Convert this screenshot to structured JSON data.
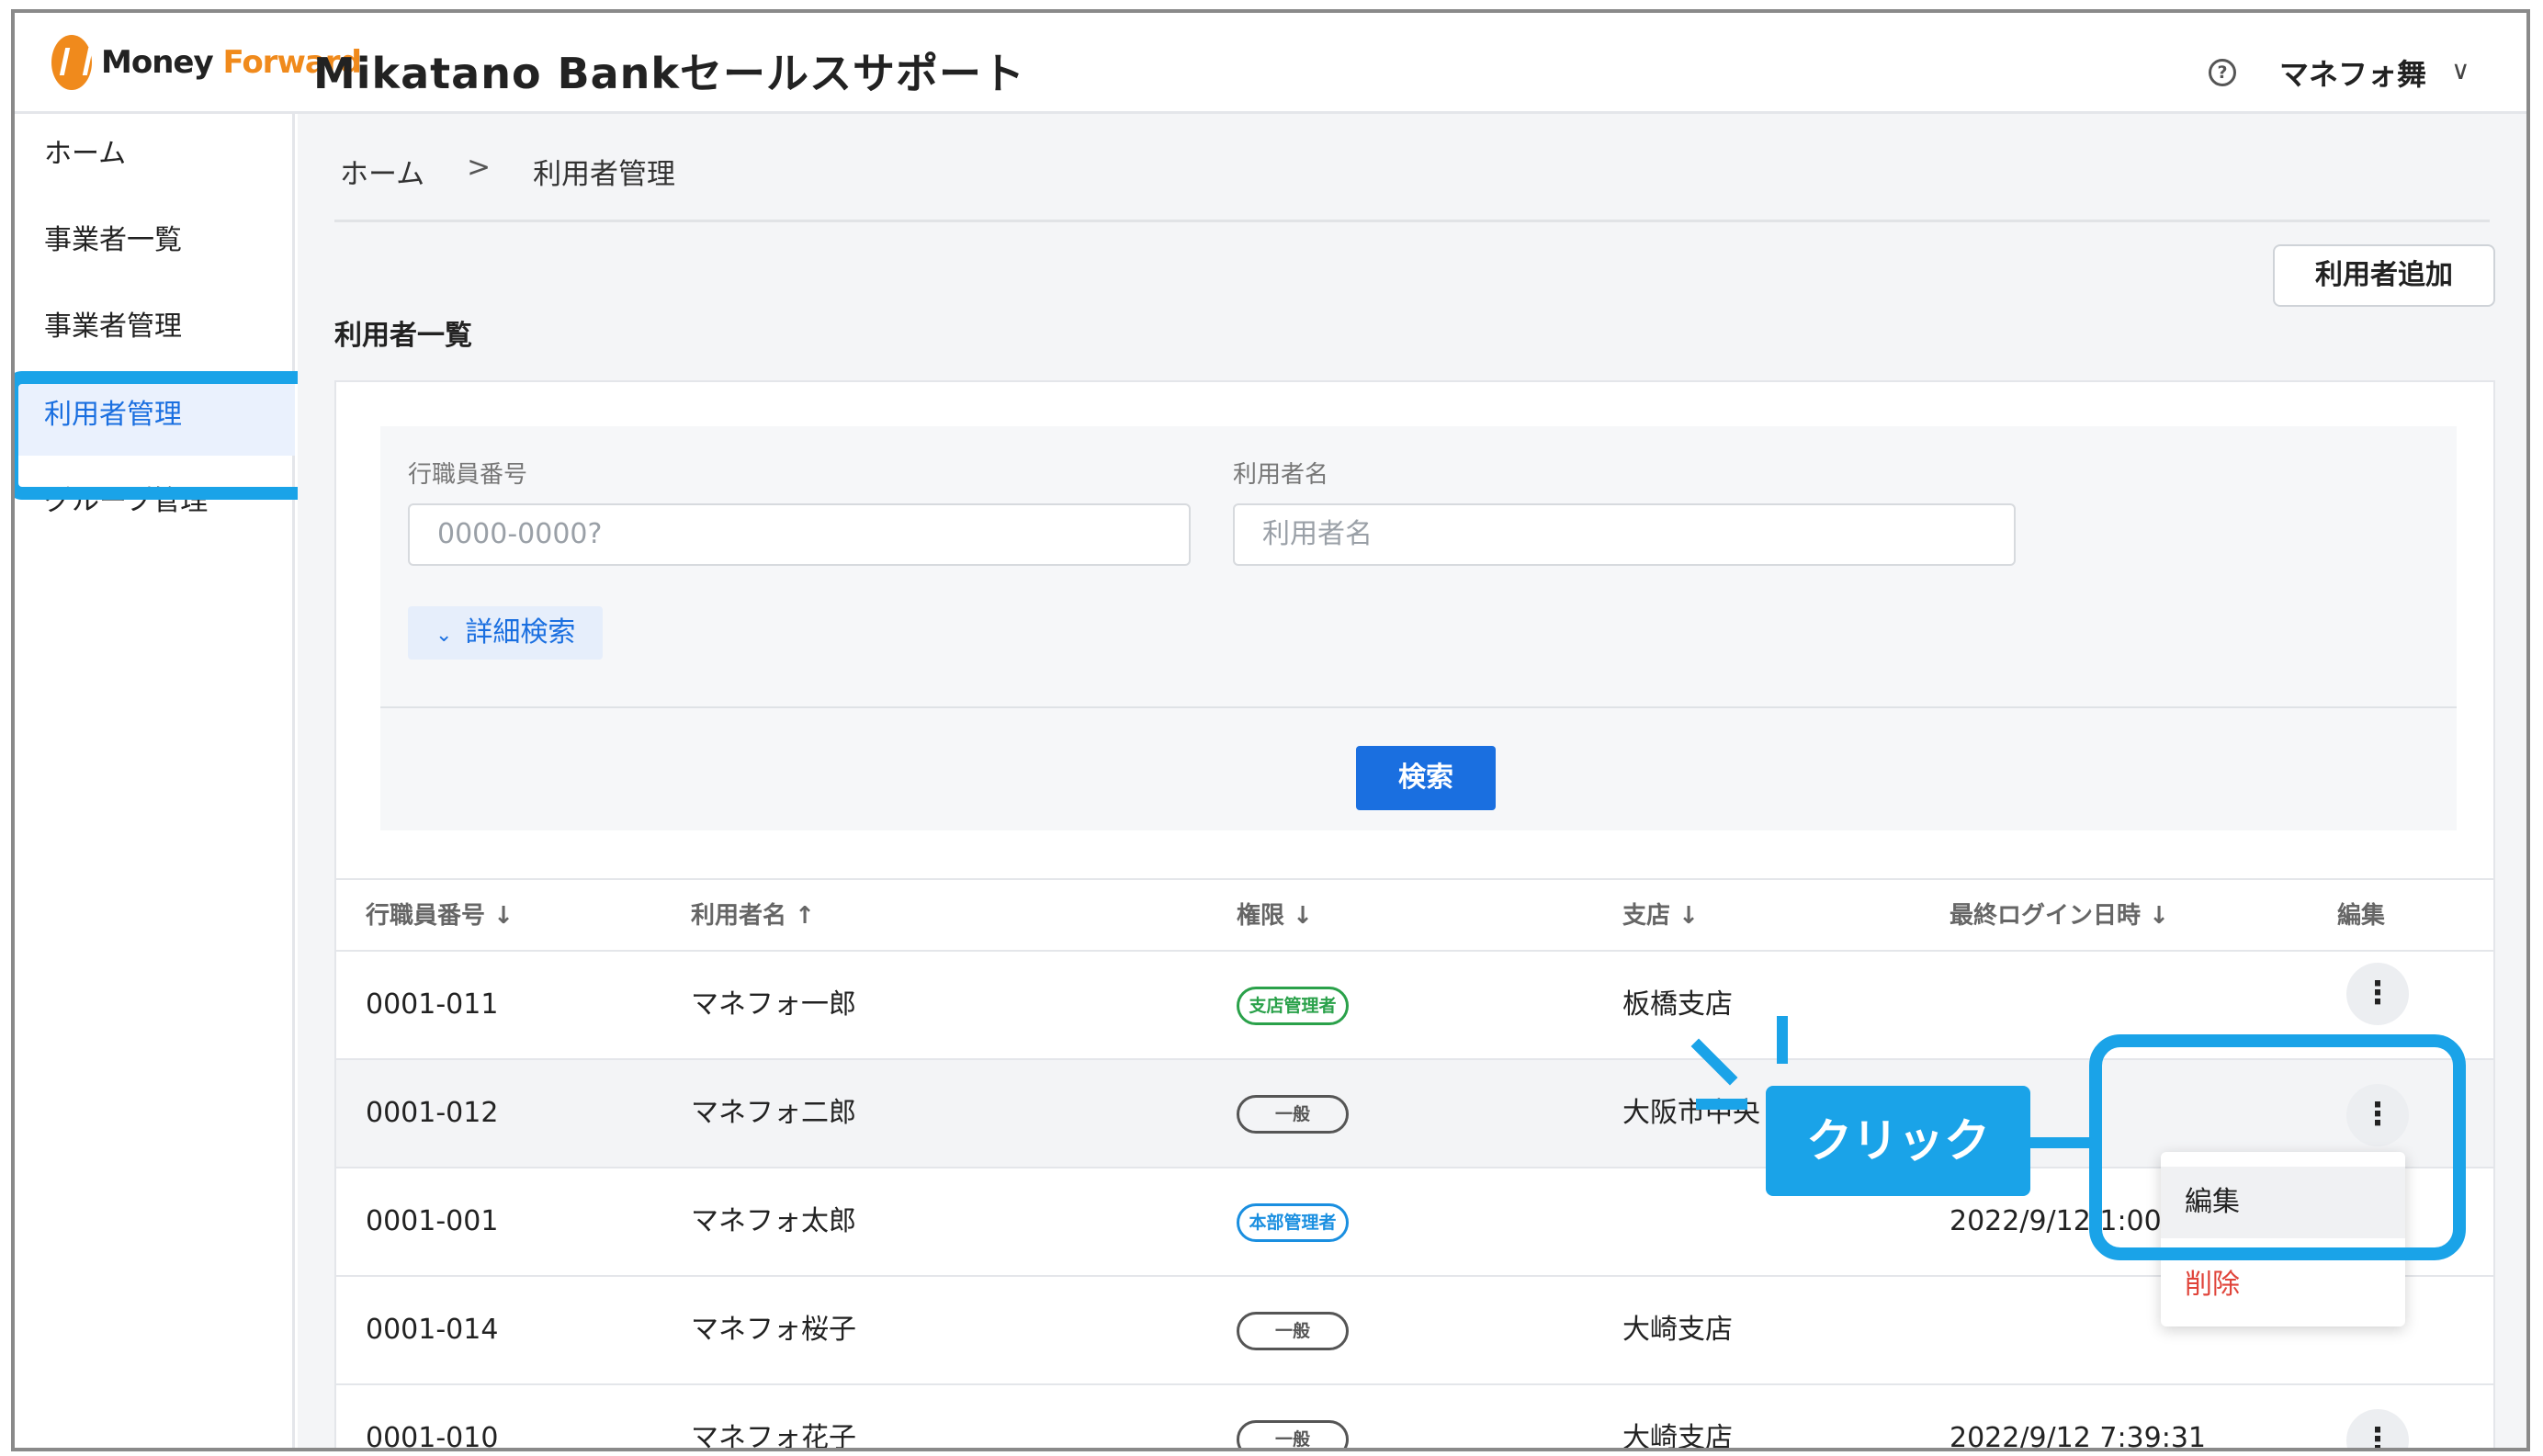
{
  "header": {
    "logo_text_money": "Money",
    "logo_text_forward": "Forward",
    "app_title": "Mikatano Bankセールスサポート",
    "help_icon": "?",
    "user_name": "マネフォ舞",
    "user_chevron": "∨"
  },
  "sidebar": {
    "items": [
      {
        "label": "ホーム"
      },
      {
        "label": "事業者一覧"
      },
      {
        "label": "事業者管理"
      },
      {
        "label": "利用者管理"
      },
      {
        "label": "グループ管理"
      }
    ]
  },
  "breadcrumb": {
    "home": "ホーム",
    "sep": ">",
    "current": "利用者管理"
  },
  "add_button": "利用者追加",
  "section_title": "利用者一覧",
  "search": {
    "employee_label": "行職員番号",
    "employee_placeholder": "0000-0000?",
    "user_label": "利用者名",
    "user_placeholder": "利用者名",
    "detail_label": "詳細検索",
    "detail_chevron": "⌄",
    "submit_label": "検索"
  },
  "table": {
    "headers": [
      {
        "label": "行職員番号",
        "sort": "↓"
      },
      {
        "label": "利用者名",
        "sort": "↑"
      },
      {
        "label": "権限",
        "sort": "↓"
      },
      {
        "label": "支店",
        "sort": "↓"
      },
      {
        "label": "最終ログイン日時",
        "sort": "↓"
      },
      {
        "label": "編集",
        "sort": ""
      }
    ],
    "rows": [
      {
        "id": "0001-011",
        "name": "マネフォ一郎",
        "role": "支店管理者",
        "branch": "板橋支店",
        "last_login": ""
      },
      {
        "id": "0001-012",
        "name": "マネフォ二郎",
        "role": "一般",
        "branch": "大阪市中央",
        "last_login": ""
      },
      {
        "id": "0001-001",
        "name": "マネフォ太郎",
        "role": "本部管理者",
        "branch": "",
        "last_login": "2022/9/12 1:00"
      },
      {
        "id": "0001-014",
        "name": "マネフォ桜子",
        "role": "一般",
        "branch": "大崎支店",
        "last_login": ""
      },
      {
        "id": "0001-010",
        "name": "マネフォ花子",
        "role": "一般",
        "branch": "大崎支店",
        "last_login": "2022/9/12 7:39:31"
      }
    ],
    "kebab": "⋮"
  },
  "context_menu": {
    "edit": "編集",
    "delete": "削除"
  },
  "callout": {
    "label": "クリック"
  },
  "colors": {
    "accent": "#1a6fe0",
    "annotation": "#1aa3e8",
    "danger": "#e0443a",
    "badge_branch": "#2aa14a",
    "badge_hq": "#1a8fe0"
  }
}
